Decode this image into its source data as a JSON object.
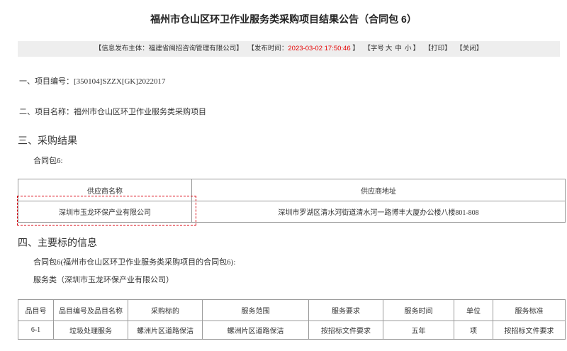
{
  "page_title": "福州市仓山区环卫作业服务类采购项目结果公告（合同包 6）",
  "info_bar": {
    "publisher": "【信息发布主体：福建省闽招咨询管理有限公司】",
    "time_prefix": "【发布时间：",
    "time_value": "2023-03-02 17:50:46",
    "time_suffix": " 】",
    "font_size_prefix": "【字号",
    "font_size_large": "大",
    "font_size_medium": "中",
    "font_size_small": "小",
    "font_size_suffix": "】",
    "print": "【打印】",
    "close": "【关闭】"
  },
  "sections": {
    "project_number": "一、项目编号：[350104]SZZX[GK]2022017",
    "project_name": "二、项目名称：福州市仓山区环卫作业服务类采购项目",
    "result_heading": "三、采购结果",
    "result_contract_label": "合同包6:",
    "subject_heading": "四、主要标的信息",
    "subject_contract_desc": "合同包6(福州市仓山区环卫作业服务类采购项目的合同包6):",
    "subject_category": "服务类（深圳市玉龙环保产业有限公司）"
  },
  "supplier_table": {
    "headers": [
      "供应商名称",
      "供应商地址"
    ],
    "rows": [
      [
        "深圳市玉龙环保产业有限公司",
        "深圳市罗湖区清水河街道清水河一路博丰大厦办公楼八楼801-808"
      ]
    ]
  },
  "subject_table": {
    "headers": [
      "品目号",
      "品目编号及品目名称",
      "采购标的",
      "服务范围",
      "服务要求",
      "服务时间",
      "单位",
      "服务标准"
    ],
    "rows": [
      [
        "6-1",
        "垃圾处理服务",
        "螺洲片区道路保洁",
        "螺洲片区道路保洁",
        "按招标文件要求",
        "五年",
        "项",
        "按招标文件要求"
      ]
    ]
  },
  "colors": {
    "text": "#333333",
    "info_bar_bg": "#eeeeee",
    "time_highlight": "#e60000",
    "highlight_box": "#d9000d",
    "table_border": "#9a9a9a"
  }
}
